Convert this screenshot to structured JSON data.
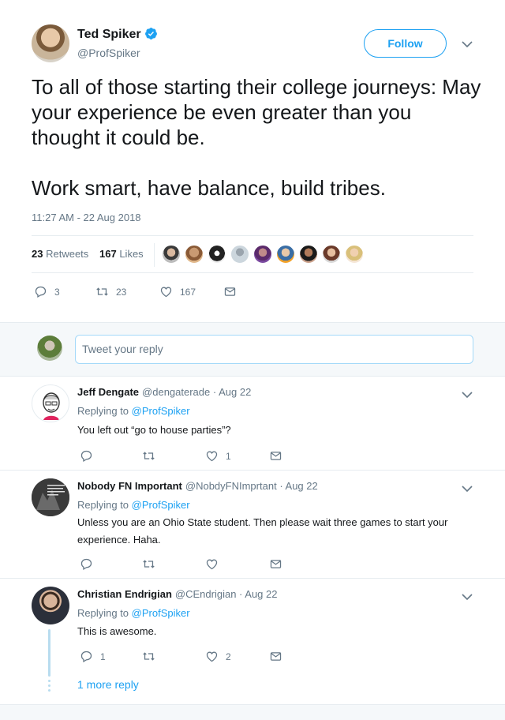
{
  "tweet": {
    "author_name": "Ted Spiker",
    "author_handle": "@ProfSpiker",
    "follow_label": "Follow",
    "text": "To all of those starting their college journeys: May your experience be even greater than you thought it could be.\n\nWork smart, have balance, build tribes.",
    "timestamp": "11:27 AM - 22 Aug 2018",
    "retweets_count": "23",
    "retweets_label": "Retweets",
    "likes_count": "167",
    "likes_label": "Likes",
    "actions": {
      "reply": "3",
      "retweet": "23",
      "like": "167"
    }
  },
  "colors": {
    "accent": "#1da1f2",
    "muted": "#657786",
    "border": "#e6ecf0",
    "background_alt": "#f5f8fa"
  },
  "reply_box": {
    "placeholder": "Tweet your reply"
  },
  "replies": [
    {
      "name": "Jeff Dengate",
      "handle": "@dengaterade",
      "date": "· Aug 22",
      "replying_prefix": "Replying to",
      "replying_to": "@ProfSpiker",
      "text": "You left out “go to house parties”?",
      "reply_count": "",
      "retweet_count": "",
      "like_count": "1"
    },
    {
      "name": "Nobody FN Important",
      "handle": "@NobdyFNImprtant",
      "date": "· Aug 22",
      "replying_prefix": "Replying to",
      "replying_to": "@ProfSpiker",
      "text": "Unless you are an Ohio State student. Then please wait three games to start your experience. Haha.",
      "reply_count": "",
      "retweet_count": "",
      "like_count": ""
    },
    {
      "name": "Christian Endrigian",
      "handle": "@CEndrigian",
      "date": "· Aug 22",
      "replying_prefix": "Replying to",
      "replying_to": "@ProfSpiker",
      "text": "This is awesome.",
      "reply_count": "1",
      "retweet_count": "",
      "like_count": "2"
    }
  ],
  "more_replies_label": "1 more reply"
}
